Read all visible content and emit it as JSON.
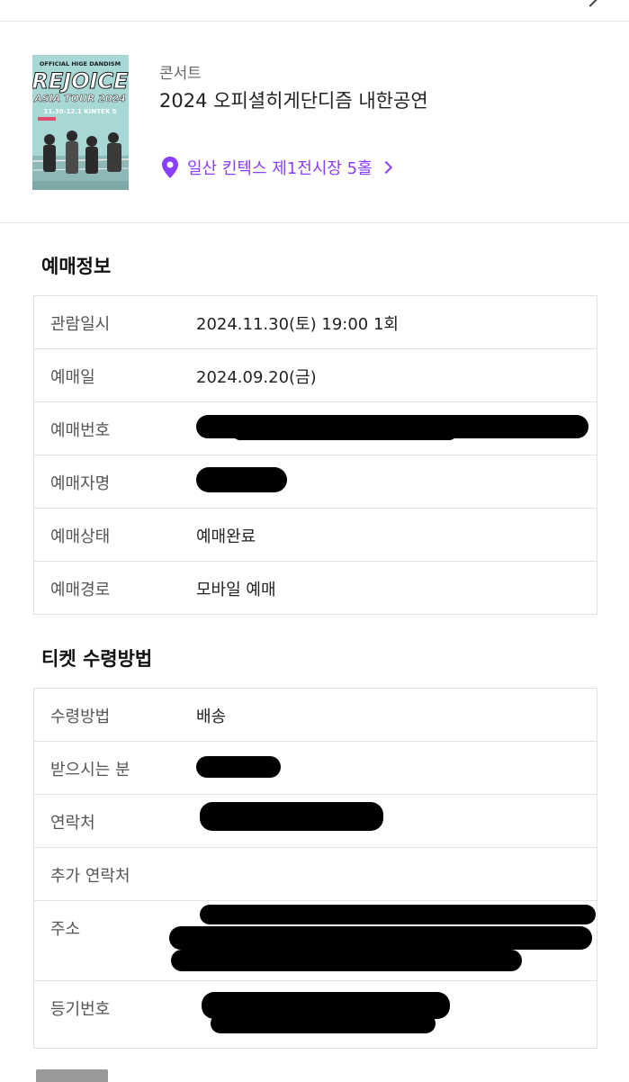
{
  "event": {
    "category": "콘서트",
    "title": "2024 오피셜히게단디즘 내한공연",
    "venue": "일산 킨텍스 제1전시장 5홀",
    "poster": {
      "top_text": "OFFICIAL HIGE DANDISM",
      "headline": "REJOICE",
      "subline": "ASIA TOUR 2024",
      "date_line": "11.30-12.1 KINTEX 5"
    }
  },
  "booking_section": {
    "heading": "예매정보",
    "rows": [
      {
        "label": "관람일시",
        "value": "2024.11.30(토) 19:00 1회"
      },
      {
        "label": "예매일",
        "value": "2024.09.20(금)"
      },
      {
        "label": "예매번호",
        "value": ""
      },
      {
        "label": "예매자명",
        "value": ""
      },
      {
        "label": "예매상태",
        "value": "예매완료"
      },
      {
        "label": "예매경로",
        "value": "모바일 예매"
      }
    ]
  },
  "ticket_section": {
    "heading": "티켓 수령방법",
    "rows": [
      {
        "label": "수령방법",
        "value": "배송"
      },
      {
        "label": "받으시는 분",
        "value": ""
      },
      {
        "label": "연락처",
        "value": ""
      },
      {
        "label": "추가 연락처",
        "value": ""
      },
      {
        "label": "주소",
        "value": ""
      },
      {
        "label": "등기번호",
        "value": ""
      }
    ]
  },
  "colors": {
    "accent": "#8a3ffc",
    "border": "#e2e2e2",
    "poster_bg": "#a8d8d6"
  },
  "icons": [
    "back-chevron-icon",
    "location-pin-icon",
    "chevron-right-icon"
  ]
}
